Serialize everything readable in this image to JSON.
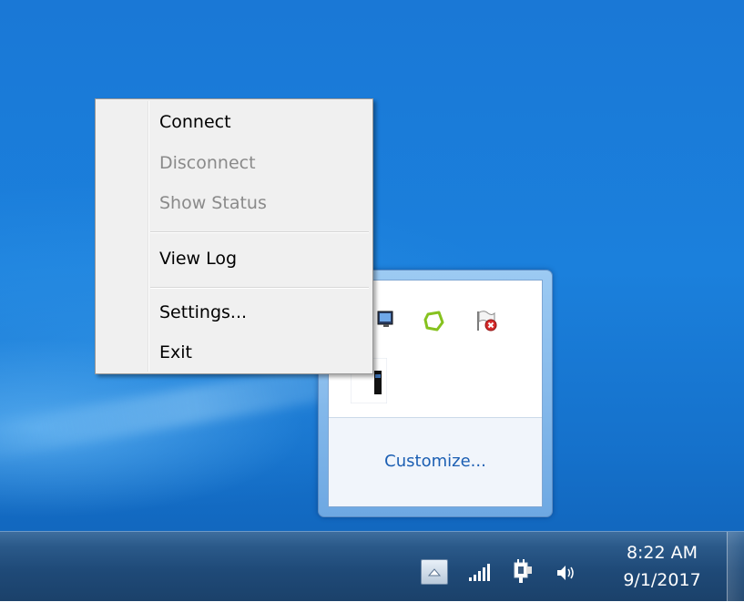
{
  "context_menu": {
    "items": [
      {
        "label": "Connect",
        "enabled": true
      },
      {
        "label": "Disconnect",
        "enabled": false
      },
      {
        "label": "Show Status",
        "enabled": false
      },
      {
        "label": "View Log",
        "enabled": true
      },
      {
        "label": "Settings...",
        "enabled": true
      },
      {
        "label": "Exit",
        "enabled": true
      }
    ]
  },
  "tray_flyout": {
    "customize_label": "Customize...",
    "icons": [
      "network-monitor-icon",
      "green-ring-app-icon",
      "action-center-flag-error-icon",
      "phone-device-icon"
    ]
  },
  "taskbar": {
    "clock": {
      "time": "8:22 AM",
      "date": "9/1/2017"
    },
    "tray_icons": [
      "show-hidden-icons-icon",
      "wireless-signal-icon",
      "power-plug-icon",
      "volume-icon"
    ]
  },
  "colors": {
    "link": "#1c5fb3",
    "disabled_text": "#8a8a8a",
    "taskbar": "#1f4a78"
  }
}
